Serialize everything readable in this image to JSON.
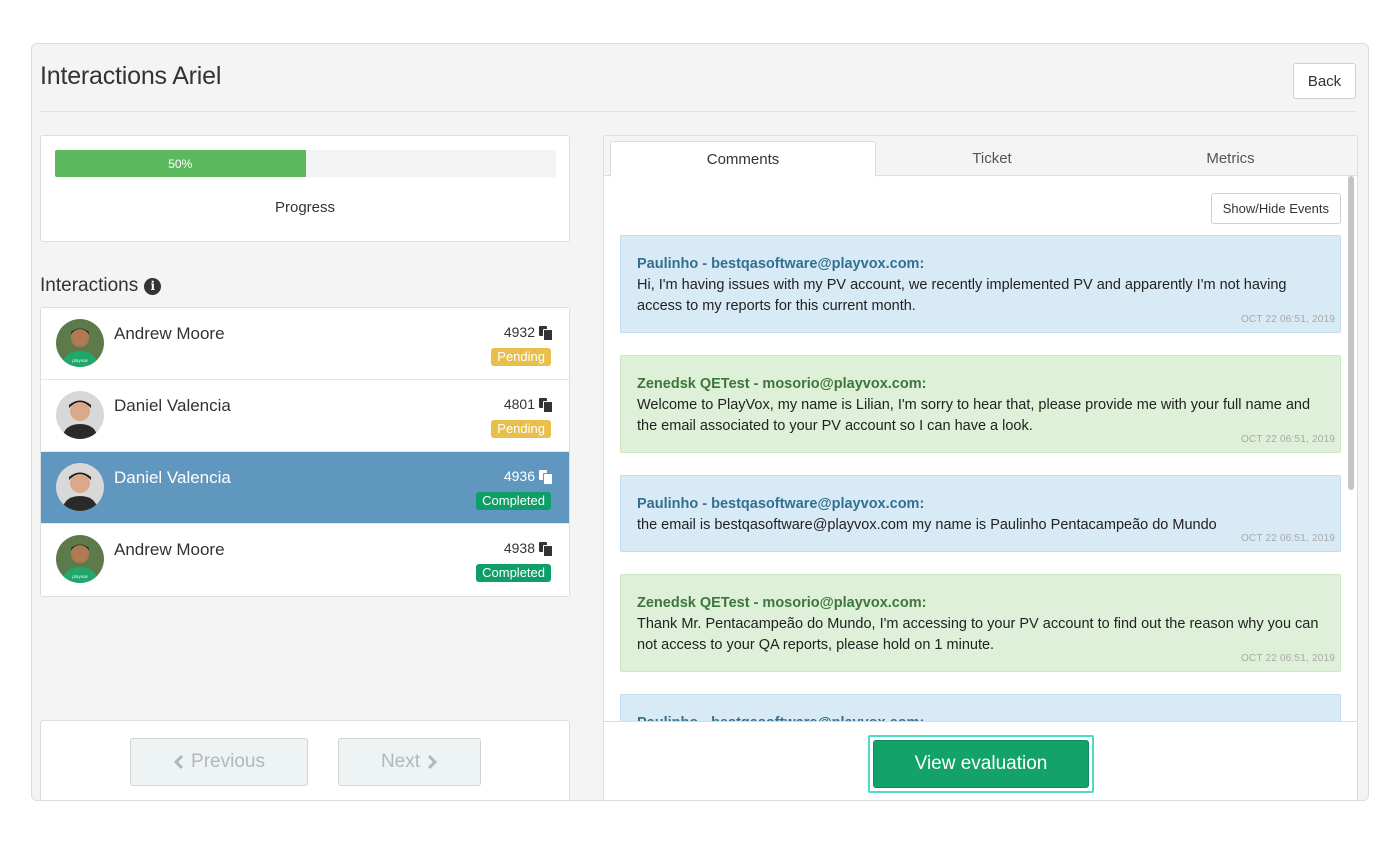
{
  "header": {
    "title": "Interactions Ariel",
    "back_label": "Back"
  },
  "progress": {
    "value_percent": 50,
    "bar_label": "50%",
    "label": "Progress",
    "color": "#5cb85c"
  },
  "interactions": {
    "heading": "Interactions",
    "info_icon": "info-circle-icon",
    "items": [
      {
        "name": "Andrew Moore",
        "id": "4932",
        "status": "Pending",
        "selected": false
      },
      {
        "name": "Daniel Valencia",
        "id": "4801",
        "status": "Pending",
        "selected": false
      },
      {
        "name": "Daniel Valencia",
        "id": "4936",
        "status": "Completed",
        "selected": true
      },
      {
        "name": "Andrew Moore",
        "id": "4938",
        "status": "Completed",
        "selected": false
      }
    ],
    "status_colors": {
      "Pending": "#e8bf4b",
      "Completed": "#0e9e68"
    },
    "selected_color": "#6097bf"
  },
  "nav": {
    "previous_label": "Previous",
    "next_label": "Next"
  },
  "tabs": [
    {
      "label": "Comments",
      "active": true
    },
    {
      "label": "Ticket",
      "active": false
    },
    {
      "label": "Metrics",
      "active": false
    }
  ],
  "comments": {
    "show_hide_label": "Show/Hide Events",
    "messages": [
      {
        "author": "Paulinho - bestqasoftware@playvox.com:",
        "text": "Hi, I'm having issues with my PV account, we recently implemented PV and apparently I'm not having access to my reports for this current month.",
        "time": "OCT 22 06:51, 2019",
        "role": "customer"
      },
      {
        "author": "Zenedsk QETest - mosorio@playvox.com:",
        "text": "Welcome to PlayVox, my name is Lilian, I'm sorry to hear that, please provide me with your full name and the email associated to your PV account so I can have a look.",
        "time": "OCT 22 06:51, 2019",
        "role": "agent"
      },
      {
        "author": "Paulinho - bestqasoftware@playvox.com:",
        "text": "the email is bestqasoftware@playvox.com my name is Paulinho Pentacampeão do Mundo",
        "time": "OCT 22 06:51, 2019",
        "role": "customer"
      },
      {
        "author": "Zenedsk QETest - mosorio@playvox.com:",
        "text": "Thank Mr. Pentacampeão do Mundo, I'm accessing to your PV account to find out the reason why you can not access to your QA reports, please hold on 1 minute.",
        "time": "OCT 22 06:51, 2019",
        "role": "agent"
      },
      {
        "author": "Paulinho - bestqasoftware@playvox.com:",
        "text": "",
        "time": "",
        "role": "customer"
      }
    ]
  },
  "footer": {
    "view_evaluation_label": "View evaluation",
    "accent": "#12a26a"
  }
}
